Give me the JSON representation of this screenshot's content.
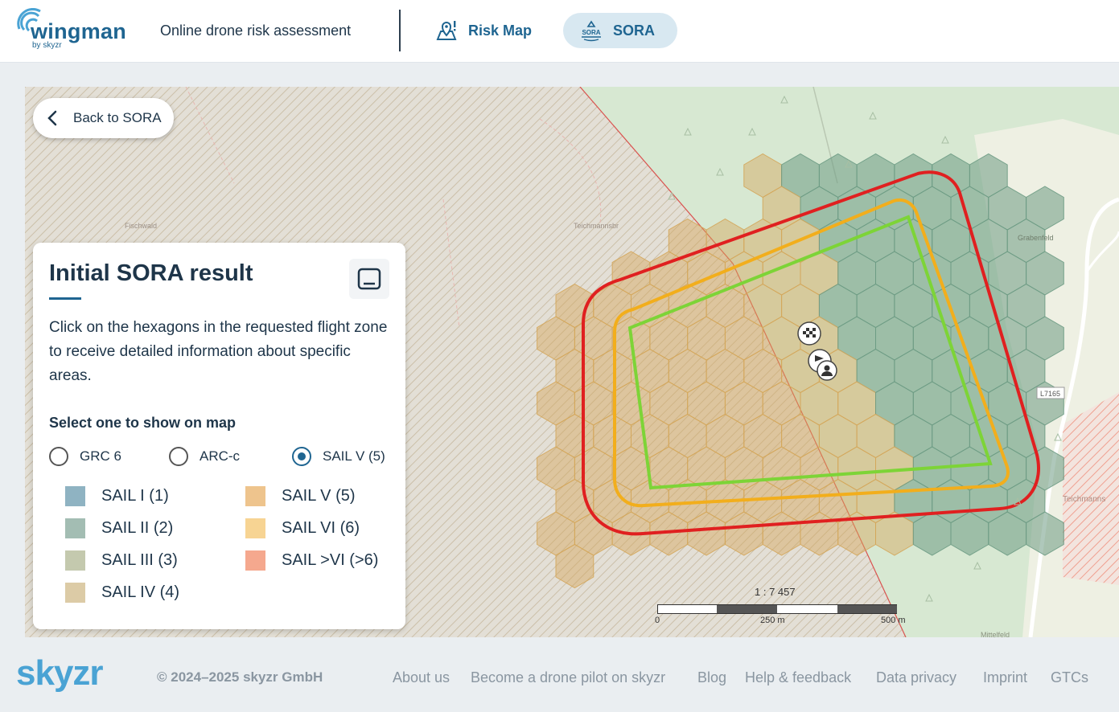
{
  "header": {
    "logo_text": "wingman",
    "logo_sub": "by skyzr",
    "app_title": "Online drone risk assessment",
    "nav": [
      {
        "label": "Risk Map",
        "icon": "map-pin-alert-icon",
        "active": false
      },
      {
        "label": "SORA",
        "icon": "sora-icon",
        "active": true
      }
    ]
  },
  "map": {
    "back_label": "Back to SORA",
    "place_labels": [
      "Fischwald",
      "Teichmannsbr",
      "Grabenfeld",
      "L7165",
      "Teichmanns",
      "Mittelfeld"
    ],
    "scale": {
      "ratio": "1 : 7 457",
      "ticks": [
        "0",
        "250 m",
        "500 m"
      ]
    }
  },
  "panel": {
    "title": "Initial SORA result",
    "description": "Click on the hexagons in the requested flight zone to receive detailed information about specific areas.",
    "select_label": "Select one to show on map",
    "options": [
      {
        "label": "GRC 6",
        "checked": false
      },
      {
        "label": "ARC-c",
        "checked": false
      },
      {
        "label": "SAIL V (5)",
        "checked": true
      }
    ],
    "legend": [
      {
        "label": "SAIL I (1)",
        "color": "#8fb3c2"
      },
      {
        "label": "SAIL II (2)",
        "color": "#a3bdb3"
      },
      {
        "label": "SAIL III (3)",
        "color": "#c4c9ae"
      },
      {
        "label": "SAIL IV (4)",
        "color": "#dccba6"
      },
      {
        "label": "SAIL V (5)",
        "color": "#eec48d"
      },
      {
        "label": "SAIL VI (6)",
        "color": "#f7d493"
      },
      {
        "label": "SAIL >VI (>6)",
        "color": "#f5a88e"
      }
    ]
  },
  "footer": {
    "logo": "skyzr",
    "copyright": "© 2024–2025 skyzr GmbH",
    "links": [
      "About us",
      "Become a drone pilot on skyzr",
      "Blog",
      "Help & feedback",
      "Data privacy",
      "Imprint",
      "GTCs"
    ]
  }
}
